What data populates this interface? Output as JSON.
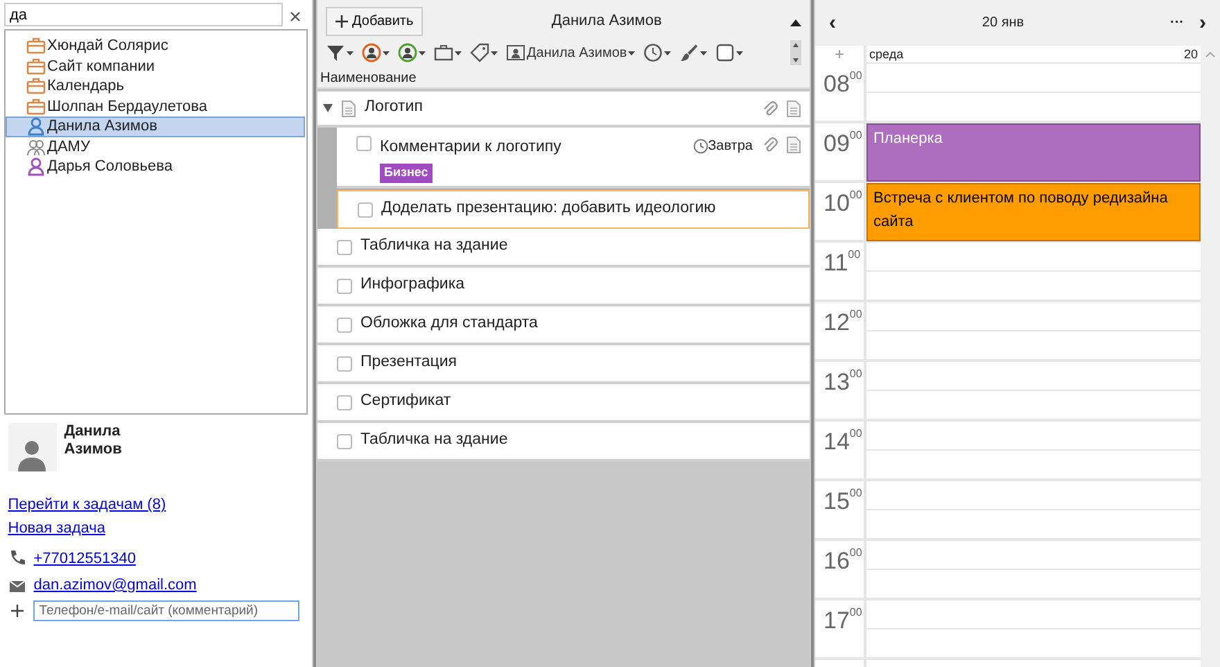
{
  "contacts_panel": {
    "search": {
      "value": "да"
    },
    "items": [
      {
        "kind": "company",
        "label": "Хюндай Солярис",
        "selected": false
      },
      {
        "kind": "company",
        "label": "Сайт компании",
        "selected": false
      },
      {
        "kind": "company",
        "label": "Календарь",
        "selected": false
      },
      {
        "kind": "company",
        "label": "Шолпан Бердаулетова",
        "selected": false
      },
      {
        "kind": "person",
        "label": "Данила Азимов",
        "selected": true
      },
      {
        "kind": "group",
        "label": "ДАМУ",
        "selected": false
      },
      {
        "kind": "person_female",
        "label": "Дарья Соловьева",
        "selected": false
      }
    ],
    "card": {
      "name": "Данила Азимов",
      "links": [
        "Перейти к задачам (8)",
        "Новая задача"
      ],
      "details": [
        {
          "kind": "phone",
          "value": "+77012551340"
        },
        {
          "kind": "email",
          "value": "dan.azimov@gmail.com"
        }
      ],
      "new_detail": {
        "placeholder": "Телефон/e-mail/сайт (комментарий)"
      }
    }
  },
  "tasks_panel": {
    "add_button": "Добавить",
    "title": "Данила Азимов",
    "toolbar": [
      {
        "kind": "filter"
      },
      {
        "kind": "person_orange"
      },
      {
        "kind": "person_green"
      },
      {
        "kind": "briefcase"
      },
      {
        "kind": "tag"
      },
      {
        "kind": "user_card",
        "label": "Данила Азимов"
      },
      {
        "kind": "clock"
      },
      {
        "kind": "brush"
      },
      {
        "kind": "square"
      }
    ],
    "column": "Наименование",
    "tasks": [
      {
        "kind": "group",
        "title": "Логотип",
        "expanded": true
      },
      {
        "kind": "subtask",
        "title": "Комментарии к логотипу",
        "checked": false,
        "due": "Завтра",
        "tag": {
          "label": "Бизнес",
          "color": "#a04cc0"
        }
      },
      {
        "kind": "subtask",
        "title": "Доделать презентацию: добавить идеологию",
        "checked": false,
        "focused": true
      },
      {
        "kind": "task",
        "title": "Табличка на здание",
        "checked": false
      },
      {
        "kind": "task",
        "title": "Инфографика",
        "checked": false
      },
      {
        "kind": "task",
        "title": "Обложка для стандарта",
        "checked": false
      },
      {
        "kind": "task",
        "title": "Презентация",
        "checked": false
      },
      {
        "kind": "task",
        "title": "Сертификат",
        "checked": false
      },
      {
        "kind": "task",
        "title": "Табличка на здание",
        "checked": false
      }
    ]
  },
  "calendar": {
    "prev": "‹",
    "date": "20 янв",
    "more": "···",
    "next": "›",
    "add": "+",
    "weekday": "среда",
    "day": "20",
    "hours": [
      {
        "label": "08$^{00}$"
      },
      {
        "label": "09$^{00}$",
        "events": [
          {
            "title": "Планерка",
            "color": "#ad6ebd"
          }
        ]
      },
      {
        "label": "10$^{00}$",
        "events": [
          {
            "title": "Встреча с клиентом по поводу редизайна сайта",
            "color": "#ff9c00"
          }
        ]
      },
      {
        "label": "11$^{00}$"
      },
      {
        "label": "12$^{00}$"
      },
      {
        "label": "13$^{00}$"
      },
      {
        "label": "14$^{00}$"
      },
      {
        "label": "15$^{00}$"
      },
      {
        "label": "16$^{00}$"
      },
      {
        "label": "17$^{00}$"
      }
    ]
  }
}
